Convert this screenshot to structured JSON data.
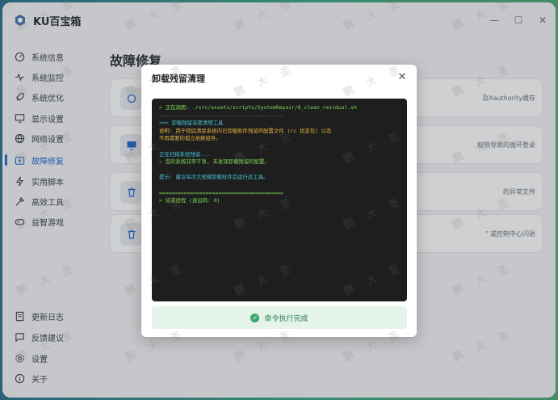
{
  "app": {
    "title": "KU百宝箱"
  },
  "window_controls": {
    "minimize": "—",
    "maximize": "☐",
    "close": "✕"
  },
  "sidebar": {
    "items": [
      {
        "label": "系统信息",
        "icon": "gauge-icon"
      },
      {
        "label": "系统监控",
        "icon": "pulse-icon"
      },
      {
        "label": "系统优化",
        "icon": "rocket-icon"
      },
      {
        "label": "显示设置",
        "icon": "monitor-icon"
      },
      {
        "label": "网络设置",
        "icon": "globe-icon"
      },
      {
        "label": "故障修复",
        "icon": "first-aid-icon",
        "active": true
      },
      {
        "label": "实用脚本",
        "icon": "bolt-icon"
      },
      {
        "label": "高效工具",
        "icon": "tools-icon"
      },
      {
        "label": "益智游戏",
        "icon": "gamepad-icon"
      }
    ],
    "bottom": [
      {
        "label": "更新日志",
        "icon": "doc-icon"
      },
      {
        "label": "反馈建议",
        "icon": "chat-icon"
      },
      {
        "label": "设置",
        "icon": "gear-icon"
      },
      {
        "label": "关于",
        "icon": "info-icon"
      }
    ]
  },
  "main": {
    "page_title": "故障修复",
    "cards": [
      {
        "text": "及Xauthority缓存",
        "icon": "refresh-icon"
      },
      {
        "text": "权限导致的循环登录",
        "icon": "monitor-icon"
      },
      {
        "text": "的异常文件",
        "icon": "trash-icon"
      },
      {
        "text": "\" 或控制中心闪退",
        "icon": "trash-icon"
      }
    ]
  },
  "modal": {
    "title": "卸载残留清理",
    "close": "✕",
    "status": "命令执行完成",
    "terminal": [
      {
        "text": "> 正在调用: ./src/assets/scripts/SystemRepair/8_clean_residual.sh",
        "color": "green"
      },
      {
        "text": "----------------------------------------",
        "color": "gray"
      },
      {
        "text": ">>> 卸载残留深度清理工具",
        "color": "cyan"
      },
      {
        "text": "说明: 用于彻底清除系统内已卸载软件残留的配置文件 (rc 状态包) 以及",
        "color": "yellow"
      },
      {
        "text": "不再需要的孤立依赖组件。",
        "color": "yellow"
      },
      {
        "text": "",
        "color": "blank"
      },
      {
        "text": "正在扫描系统残留...",
        "color": "cyan"
      },
      {
        "text": "✓ 您的系统非常干净, 未发现卸载残留的配置。",
        "color": "green"
      },
      {
        "text": "",
        "color": "blank"
      },
      {
        "text": "提示: 建议每次大规模卸载软件后运行此工具。",
        "color": "cyan"
      },
      {
        "text": "",
        "color": "blank"
      },
      {
        "text": "========================================",
        "color": "green"
      },
      {
        "text": "> 结束进程 (退出码: 0)",
        "color": "green"
      }
    ]
  },
  "watermark": {
    "chars": [
      "鹏",
      "大",
      "圣"
    ]
  }
}
